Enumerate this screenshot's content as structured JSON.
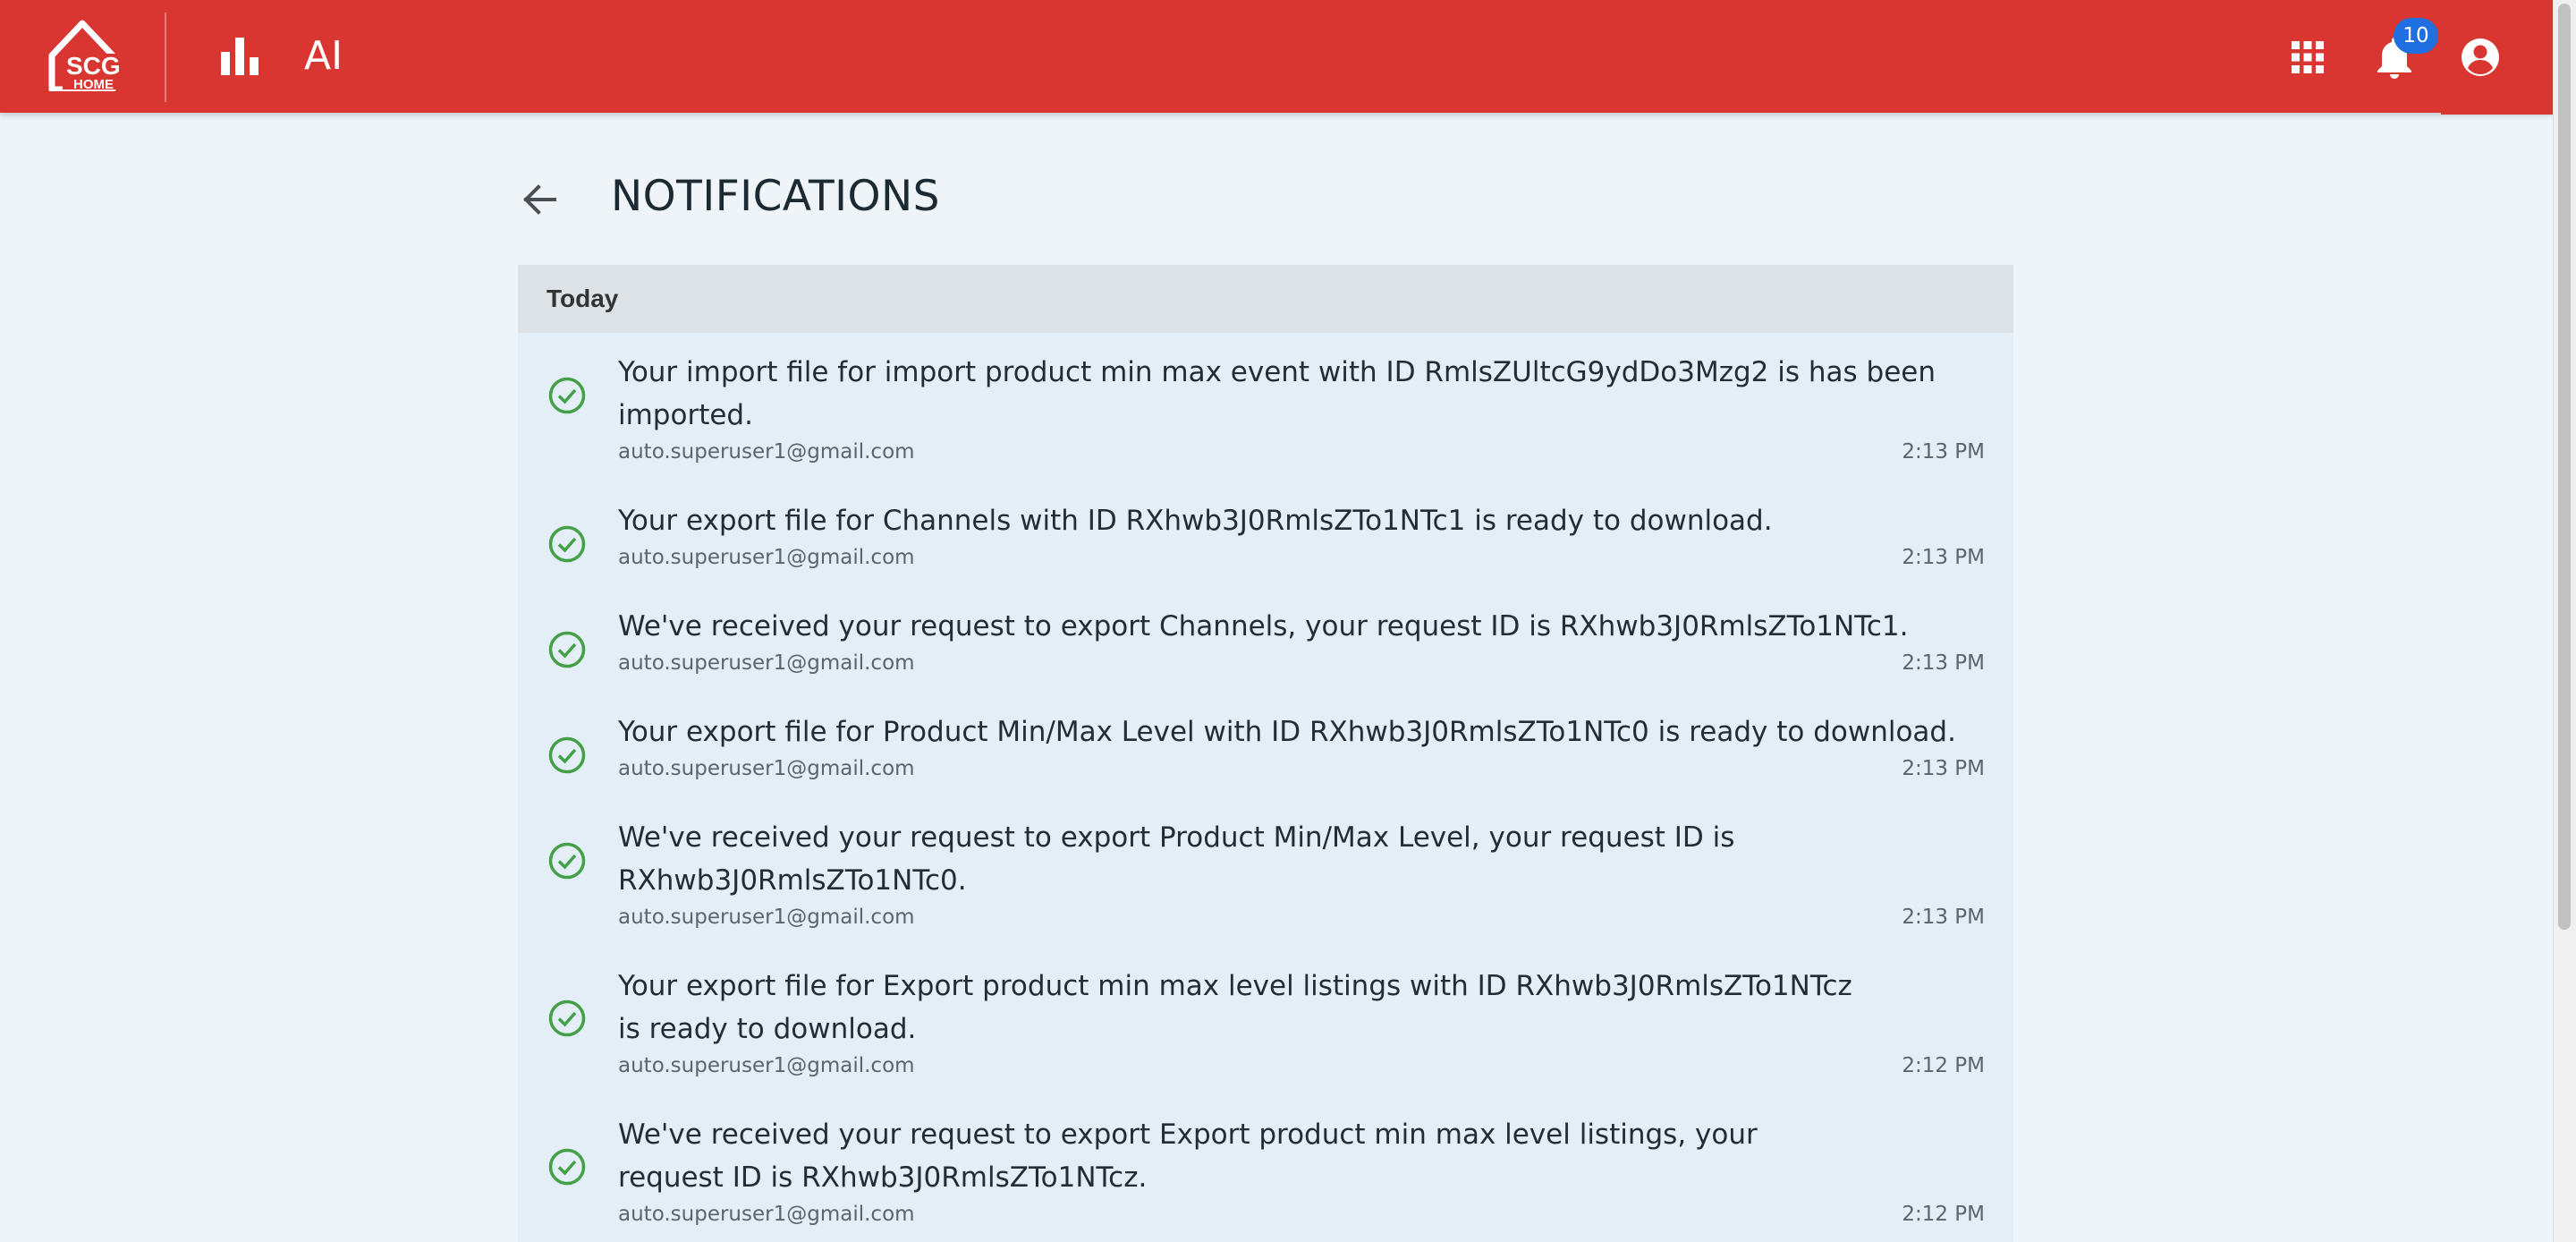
{
  "header": {
    "logo_text_top": "SCG",
    "logo_text_bottom": "HOME",
    "nav_label": "AI",
    "notification_count": "10"
  },
  "page": {
    "title": "NOTIFICATIONS",
    "section_label": "Today"
  },
  "notifications": [
    {
      "message": "Your import file for import product min max event with ID RmlsZUltcG9ydDo3Mzg2 is has been imported.",
      "user": "auto.superuser1@gmail.com",
      "time": "2:13 PM"
    },
    {
      "message": "Your export file for Channels with ID RXhwb3J0RmlsZTo1NTc1 is ready to download.",
      "user": "auto.superuser1@gmail.com",
      "time": "2:13 PM"
    },
    {
      "message": "We've received your request to export Channels, your request ID is RXhwb3J0RmlsZTo1NTc1.",
      "user": "auto.superuser1@gmail.com",
      "time": "2:13 PM"
    },
    {
      "message": "Your export file for Product Min/Max Level with ID RXhwb3J0RmlsZTo1NTc0 is ready to download.",
      "user": "auto.superuser1@gmail.com",
      "time": "2:13 PM"
    },
    {
      "message": "We've received your request to export Product Min/Max Level, your request ID is RXhwb3J0RmlsZTo1NTc0.",
      "user": "auto.superuser1@gmail.com",
      "time": "2:13 PM"
    },
    {
      "message": "Your export file for Export product min max level listings with ID RXhwb3J0RmlsZTo1NTcz is ready to download.",
      "user": "auto.superuser1@gmail.com",
      "time": "2:12 PM"
    },
    {
      "message": "We've received your request to export Export product min max level listings, your request ID is RXhwb3J0RmlsZTo1NTcz.",
      "user": "auto.superuser1@gmail.com",
      "time": "2:12 PM"
    }
  ],
  "colors": {
    "header_bg": "#d93632",
    "badge_bg": "#1f6fe0",
    "success_check": "#43a047",
    "panel_bg": "#e3eef7",
    "section_header_bg": "#dde2e6"
  },
  "icons": {
    "logo": "house-logo-icon",
    "nav": "bar-chart-icon",
    "apps": "apps-grid-icon",
    "notifications": "bell-icon",
    "account": "account-circle-icon",
    "back": "arrow-back-icon",
    "status": "check-circle-outline-icon"
  }
}
